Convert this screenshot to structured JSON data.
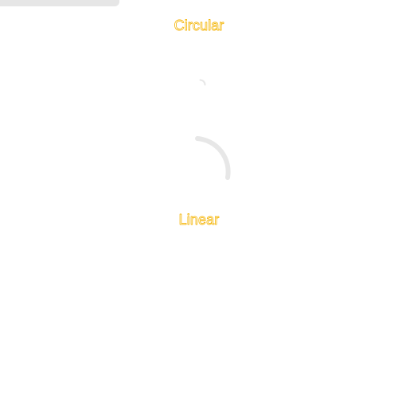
{
  "header": {
    "progress": 0.3
  },
  "circular": {
    "title": "Circular",
    "spinners": [
      {
        "size": "small",
        "progress": 0.22
      },
      {
        "size": "large",
        "progress": 0.36
      }
    ]
  },
  "linear": {
    "title": "Linear",
    "progress": 0
  },
  "colors": {
    "background": "#ffffff",
    "track": "#e6e6e6",
    "title_outline": "#f2b600"
  },
  "icons": {
    "small_spinner": "circular-spinner-icon",
    "large_spinner": "circular-spinner-icon"
  }
}
